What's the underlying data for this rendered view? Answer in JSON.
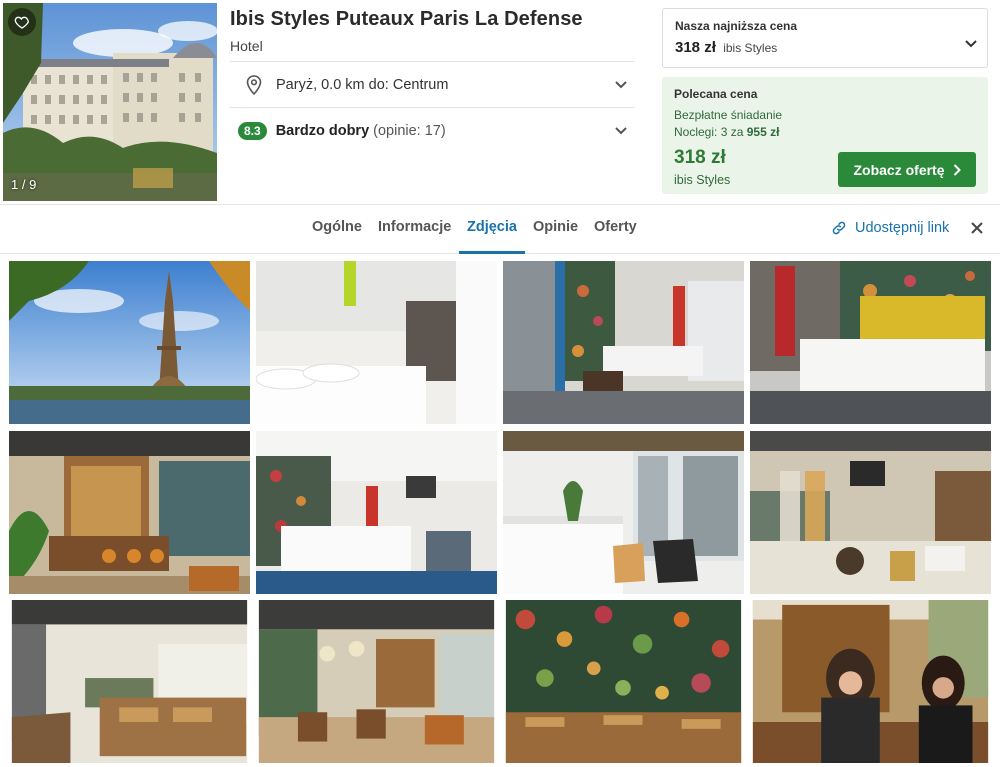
{
  "hotel": {
    "name": "Ibis Styles Puteaux Paris La Defense",
    "type": "Hotel",
    "photo_counter": "1 / 9",
    "location": "Paryż, 0.0 km do: Centrum",
    "score": "8.3",
    "rating_label": "Bardzo dobry",
    "rating_count": "(opinie: 17)"
  },
  "lowest_price": {
    "label": "Nasza najniższa cena",
    "price": "318 zł",
    "provider": "ibis Styles"
  },
  "recommended": {
    "title": "Polecana cena",
    "breakfast": "Bezpłatne śniadanie",
    "nights_prefix": "Noclegi: 3 za",
    "nights_total": "955 zł",
    "price": "318 zł",
    "provider": "ibis Styles",
    "button_label": "Zobacz ofertę"
  },
  "tabs": [
    {
      "label": "Ogólne"
    },
    {
      "label": "Informacje"
    },
    {
      "label": "Zdjęcia",
      "active": true
    },
    {
      "label": "Opinie"
    },
    {
      "label": "Oferty"
    }
  ],
  "share_label": "Udostępnij link",
  "gallery": [
    {
      "name": "eiffel-tower-photo"
    },
    {
      "name": "white-bedroom-photo"
    },
    {
      "name": "bedroom-floral-wall-photo"
    },
    {
      "name": "bedroom-yellow-headboard-photo"
    },
    {
      "name": "bar-area-photo"
    },
    {
      "name": "bedroom-red-flowers-photo"
    },
    {
      "name": "reception-chairs-photo"
    },
    {
      "name": "breakfast-cereal-photo"
    },
    {
      "name": "breakfast-room-photo"
    },
    {
      "name": "lounge-bar-photo"
    },
    {
      "name": "jungle-wallpaper-restaurant-photo"
    },
    {
      "name": "women-at-bar-photo"
    }
  ],
  "colors": {
    "accent": "#1a73a8",
    "green": "#2a8a3a",
    "recommended_bg": "#ebf4e8"
  }
}
